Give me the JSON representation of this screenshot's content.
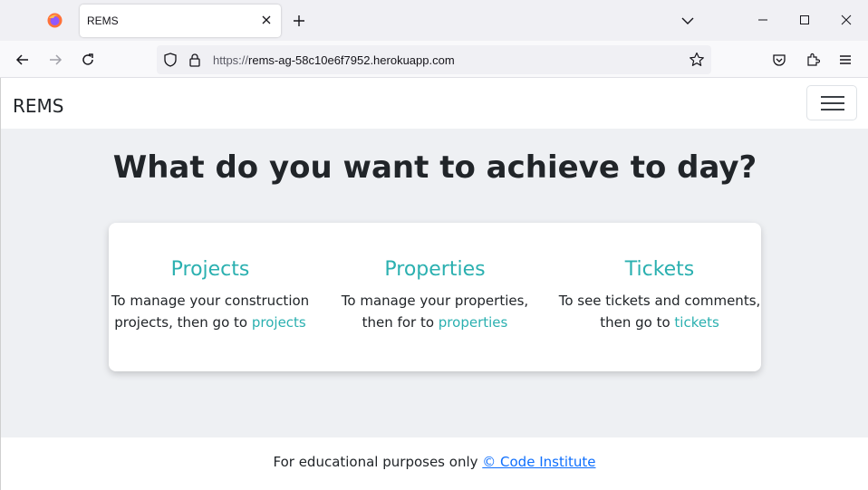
{
  "browser": {
    "tab_title": "REMS",
    "url_scheme": "https://",
    "url_host": "rems-ag-58c10e6f7952.herokuapp.com"
  },
  "site": {
    "brand": "REMS",
    "heading": "What do you want to achieve to day?",
    "sections": [
      {
        "title": "Projects",
        "text_line1": "To manage your construction",
        "text_line2": "projects, then go to ",
        "link": "projects"
      },
      {
        "title": "Properties",
        "text_line1": "To manage your properties,",
        "text_line2": "then for to ",
        "link": "properties"
      },
      {
        "title": "Tickets",
        "text_line1": "To see tickets and comments,",
        "text_line2": "then go to ",
        "link": "tickets"
      }
    ],
    "footer_text": "For educational purposes only ",
    "footer_link": "© Code Institute"
  },
  "colors": {
    "accent": "#2bb0b0",
    "footer_link": "#0d6efd",
    "main_bg": "#eef0f3"
  },
  "icons": [
    "firefox-icon",
    "close-icon",
    "plus-icon",
    "chevron-down-icon",
    "minimize-icon",
    "maximize-icon",
    "window-close-icon",
    "back-arrow-icon",
    "forward-arrow-icon",
    "reload-icon",
    "shield-icon",
    "lock-icon",
    "star-icon",
    "pocket-icon",
    "extensions-icon",
    "hamburger-menu-icon"
  ]
}
